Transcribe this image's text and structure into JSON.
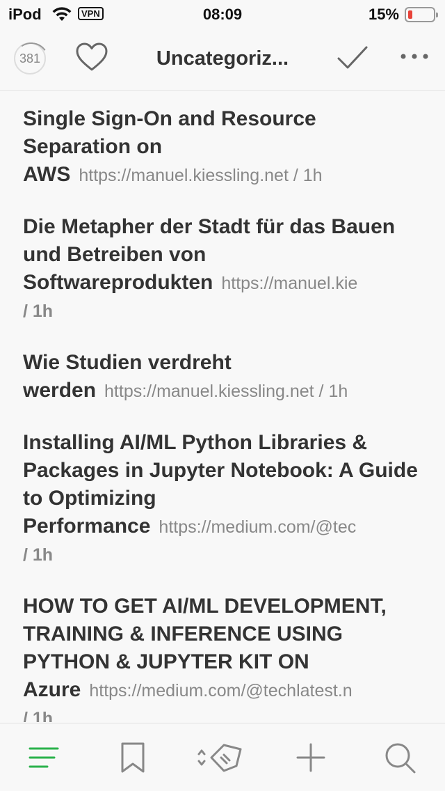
{
  "status_bar": {
    "carrier": "iPod",
    "vpn": "VPN",
    "time": "08:09",
    "battery_pct": "15%"
  },
  "navbar": {
    "unread_count": "381",
    "title": "Uncategoriz..."
  },
  "articles": [
    {
      "title_main": "Single Sign-On and Resource Separation on",
      "title_last": "AWS",
      "url": "https://manuel.kiessling.net",
      "age": "/ 1h"
    },
    {
      "title_main": "Die Metapher der Stadt für das Bauen und Betreiben von",
      "title_last": "Softwareprodukten",
      "url": "https://manuel.kie",
      "age": "/ 1h"
    },
    {
      "title_main": "Wie Studien verdreht",
      "title_last": "werden",
      "url": "https://manuel.kiessling.net",
      "age": "/ 1h"
    },
    {
      "title_main": "Installing AI/ML Python Libraries & Packages in Jupyter Notebook: A Guide to Optimizing",
      "title_last": "Performance",
      "url": "https://medium.com/@tec",
      "age": "/ 1h"
    },
    {
      "title_main": "HOW TO GET AI/ML DEVELOPMENT, TRAINING & INFERENCE USING PYTHON & JUPYTER KIT ON",
      "title_last": "Azure",
      "url": "https://medium.com/@techlatest.n",
      "age": "/ 1h"
    }
  ],
  "tabbar": {
    "tabs": [
      "list-icon",
      "bookmark-icon",
      "tag-icon",
      "add-icon",
      "search-icon"
    ],
    "active_color": "#2bb24c"
  }
}
